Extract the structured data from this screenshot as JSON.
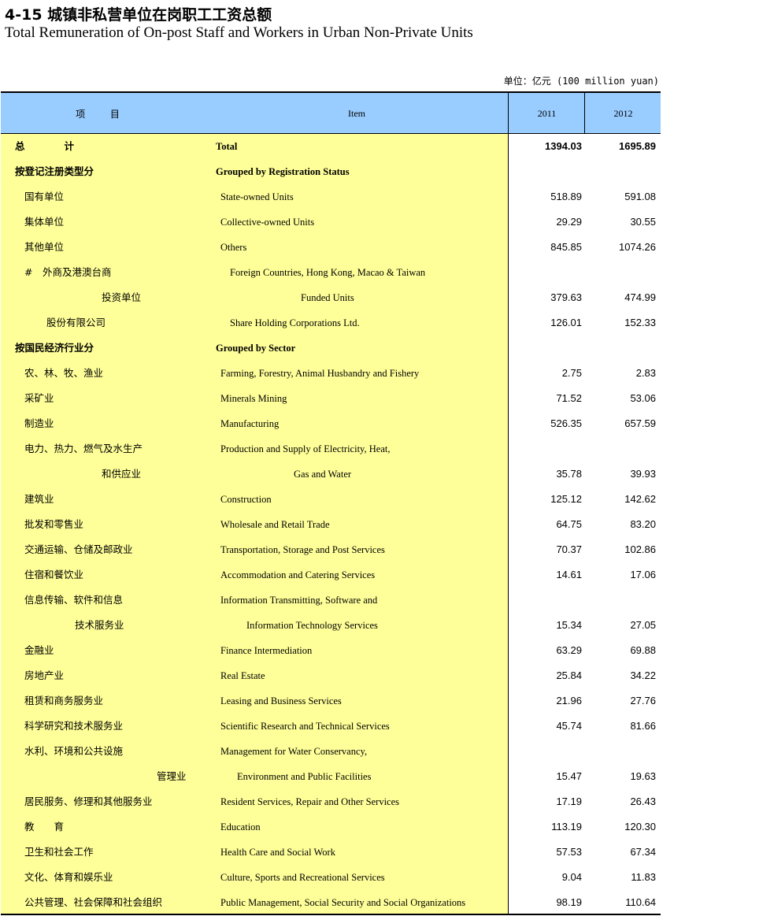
{
  "title_cn": "4-15 城镇非私营单位在岗职工工资总额",
  "title_en": "Total Remuneration of On-post Staff and Workers in Urban Non-Private Units",
  "unit": "单位：亿元 (100 million yuan)",
  "header": {
    "item_cn": "项 目",
    "item_en": "Item",
    "year1": "2011",
    "year2": "2012"
  },
  "rows": [
    {
      "cn": "总　　　　计",
      "en": "Total",
      "v1": "1394.03",
      "v2": "1695.89"
    },
    {
      "cn": "按登记注册类型分",
      "en": "Grouped by Registration Status",
      "v1": "",
      "v2": ""
    },
    {
      "cn": "国有单位",
      "en": "State-owned Units",
      "v1": "518.89",
      "v2": "591.08"
    },
    {
      "cn": "集体单位",
      "en": "Collective-owned Units",
      "v1": "29.29",
      "v2": "30.55"
    },
    {
      "cn": "其他单位",
      "en": "Others",
      "v1": "845.85",
      "v2": "1074.26"
    },
    {
      "cn": "#　外商及港澳台商",
      "en": "Foreign Countries, Hong Kong, Macao & Taiwan",
      "v1": "",
      "v2": ""
    },
    {
      "cn": "投资单位",
      "en": "Funded Units",
      "v1": "379.63",
      "v2": "474.99"
    },
    {
      "cn": "股份有限公司",
      "en": "Share Holding Corporations Ltd.",
      "v1": "126.01",
      "v2": "152.33"
    },
    {
      "cn": "按国民经济行业分",
      "en": "Grouped by Sector",
      "v1": "",
      "v2": ""
    },
    {
      "cn": "农、林、牧、渔业",
      "en": "Farming, Forestry, Animal Husbandry and Fishery",
      "v1": "2.75",
      "v2": "2.83"
    },
    {
      "cn": "采矿业",
      "en": "Minerals Mining",
      "v1": "71.52",
      "v2": "53.06"
    },
    {
      "cn": "制造业",
      "en": "Manufacturing",
      "v1": "526.35",
      "v2": "657.59"
    },
    {
      "cn": "电力、热力、燃气及水生产",
      "en": "Production and Supply of Electricity, Heat,",
      "v1": "",
      "v2": ""
    },
    {
      "cn": "和供应业",
      "en": "Gas and Water",
      "v1": "35.78",
      "v2": "39.93"
    },
    {
      "cn": "建筑业",
      "en": "Construction",
      "v1": "125.12",
      "v2": "142.62"
    },
    {
      "cn": "批发和零售业",
      "en": "Wholesale and Retail Trade",
      "v1": "64.75",
      "v2": "83.20"
    },
    {
      "cn": "交通运输、仓储及邮政业",
      "en": "Transportation, Storage and Post Services",
      "v1": "70.37",
      "v2": "102.86"
    },
    {
      "cn": "住宿和餐饮业",
      "en": "Accommodation and Catering Services",
      "v1": "14.61",
      "v2": "17.06"
    },
    {
      "cn": "信息传输、软件和信息",
      "en": "Information Transmitting, Software and",
      "v1": "",
      "v2": ""
    },
    {
      "cn": "技术服务业",
      "en": "Information Technology Services",
      "v1": "15.34",
      "v2": "27.05"
    },
    {
      "cn": "金融业",
      "en": "Finance Intermediation",
      "v1": "63.29",
      "v2": "69.88"
    },
    {
      "cn": "房地产业",
      "en": "Real Estate",
      "v1": "25.84",
      "v2": "34.22"
    },
    {
      "cn": "租赁和商务服务业",
      "en": "Leasing and Business Services",
      "v1": "21.96",
      "v2": "27.76"
    },
    {
      "cn": "科学研究和技术服务业",
      "en": "Scientific Research and Technical Services",
      "v1": "45.74",
      "v2": "81.66"
    },
    {
      "cn": "水利、环境和公共设施",
      "en": "Management for Water Conservancy,",
      "v1": "",
      "v2": ""
    },
    {
      "cn": "管理业",
      "en": "Environment and Public Facilities",
      "v1": "15.47",
      "v2": "19.63"
    },
    {
      "cn": "居民服务、修理和其他服务业",
      "en": "Resident Services, Repair and Other Services",
      "v1": "17.19",
      "v2": "26.43"
    },
    {
      "cn": "教　　育",
      "en": "Education",
      "v1": "113.19",
      "v2": "120.30"
    },
    {
      "cn": "卫生和社会工作",
      "en": "Health Care and Social Work",
      "v1": "57.53",
      "v2": "67.34"
    },
    {
      "cn": "文化、体育和娱乐业",
      "en": "Culture, Sports and Recreational Services",
      "v1": "9.04",
      "v2": "11.83"
    },
    {
      "cn": "公共管理、社会保障和社会组织",
      "en": "Public Management, Social Security and Social Organizations",
      "v1": "98.19",
      "v2": "110.64"
    }
  ]
}
